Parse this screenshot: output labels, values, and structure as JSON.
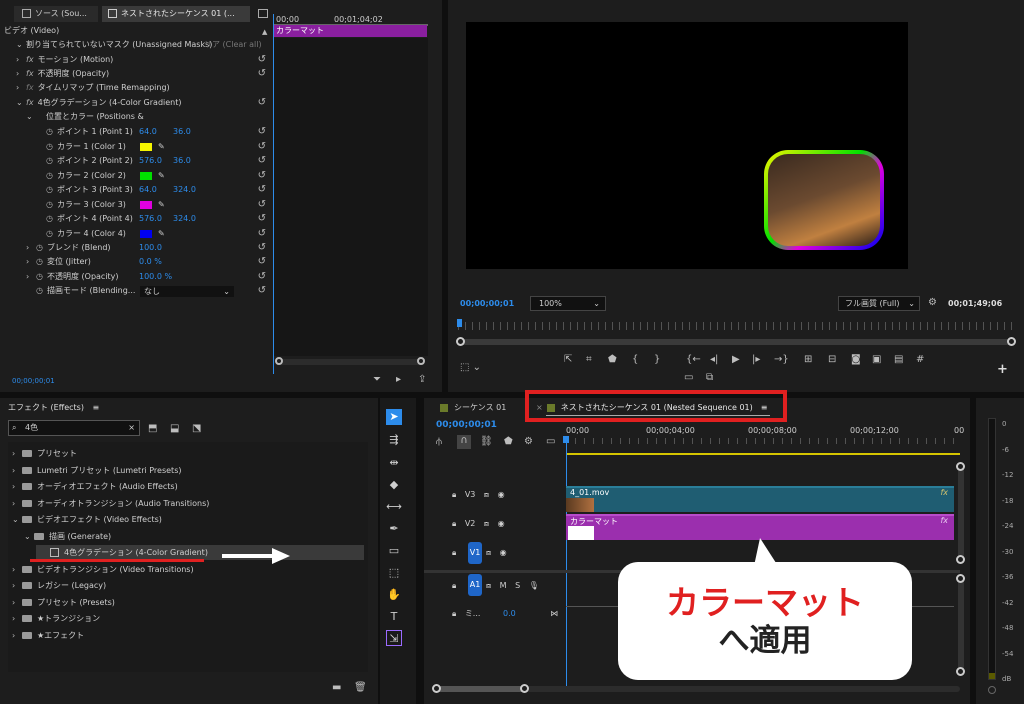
{
  "effect_controls": {
    "tabs": [
      "ソース (Sou...",
      "ネストされたシーケンス 01 (..."
    ],
    "timecode_start": "00;00",
    "timecode_end": "00;01;04;02",
    "clip_label": "カラーマット",
    "section_video": "ビデオ (Video)",
    "mask_row": "割り当てられていないマスク (Unassigned Masks)",
    "clear_all": "リア (Clear all)",
    "motion": "モーション (Motion)",
    "opacity": "不透明度 (Opacity)",
    "time_remap": "タイムリマップ (Time Remapping)",
    "gradient": "4色グラデーション (4-Color Gradient)",
    "pos_colors": "位置とカラー (Positions &",
    "params": [
      {
        "label": "ポイント 1 (Point 1)",
        "v1": "64.0",
        "v2": "36.0"
      },
      {
        "label": "カラー 1 (Color 1)",
        "color": "#f5f500"
      },
      {
        "label": "ポイント 2 (Point 2)",
        "v1": "576.0",
        "v2": "36.0"
      },
      {
        "label": "カラー 2 (Color 2)",
        "color": "#00e000"
      },
      {
        "label": "ポイント 3 (Point 3)",
        "v1": "64.0",
        "v2": "324.0"
      },
      {
        "label": "カラー 3 (Color 3)",
        "color": "#e000e0"
      },
      {
        "label": "ポイント 4 (Point 4)",
        "v1": "576.0",
        "v2": "324.0"
      },
      {
        "label": "カラー 4 (Color 4)",
        "color": "#0000f0"
      }
    ],
    "blend": "ブレンド (Blend)",
    "blend_val": "100.0",
    "jitter": "変位 (Jitter)",
    "jitter_val": "0.0 %",
    "opacity2": "不透明度 (Opacity)",
    "opacity2_val": "100.0 %",
    "blend_mode": "描画モード (Blending...",
    "blend_mode_val": "なし",
    "footer_timecode": "00;00;00;01"
  },
  "program": {
    "timecode": "00;00;00;01",
    "zoom": "100%",
    "quality": "フル画質 (Full)",
    "duration": "00;01;49;06"
  },
  "effects_panel": {
    "title": "エフェクト (Effects)",
    "search_value": "4色",
    "items": [
      {
        "label": "プリセット",
        "indent": 0,
        "open": false
      },
      {
        "label": "Lumetri プリセット (Lumetri Presets)",
        "indent": 0,
        "open": false
      },
      {
        "label": "オーディオエフェクト (Audio Effects)",
        "indent": 0,
        "open": false
      },
      {
        "label": "オーディオトランジション (Audio Transitions)",
        "indent": 0,
        "open": false
      },
      {
        "label": "ビデオエフェクト (Video Effects)",
        "indent": 0,
        "open": true
      },
      {
        "label": "描画 (Generate)",
        "indent": 1,
        "open": true
      },
      {
        "label": "4色グラデーション (4-Color Gradient)",
        "indent": 2,
        "leaf": true
      },
      {
        "label": "ビデオトランジション (Video Transitions)",
        "indent": 0,
        "open": false
      },
      {
        "label": "レガシー (Legacy)",
        "indent": 0,
        "open": false
      },
      {
        "label": "プリセット (Presets)",
        "indent": 0,
        "open": false
      },
      {
        "label": "★トランジション",
        "indent": 0,
        "open": false
      },
      {
        "label": "★エフェクト",
        "indent": 0,
        "open": false
      }
    ]
  },
  "timeline": {
    "tab1": "シーケンス 01",
    "tab2": "ネストされたシーケンス 01 (Nested Sequence 01)",
    "timecode": "00;00;00;01",
    "ruler": [
      "00;00",
      "00;00;04;00",
      "00;00;08;00",
      "00;00;12;00",
      "00"
    ],
    "tracks": {
      "v3": "V3",
      "v2": "V2",
      "v1": "V1",
      "a1": "A1",
      "m": "M",
      "s": "S",
      "mix": "ミ...",
      "mix_val": "0.0"
    },
    "clip_v3": "4_01.mov",
    "clip_v2": "カラーマット"
  },
  "meter": {
    "ticks": [
      "0",
      "-6",
      "-12",
      "-18",
      "-24",
      "-30",
      "-36",
      "-42",
      "-48",
      "-54",
      "dB"
    ]
  },
  "callout": {
    "line1": "カラーマット",
    "line2": "へ適用"
  },
  "colors": {
    "accent_red": "#e02020",
    "clip_purple": "#9b2fae",
    "clip_teal": "#1f6e86",
    "blue": "#2d8ceb"
  }
}
